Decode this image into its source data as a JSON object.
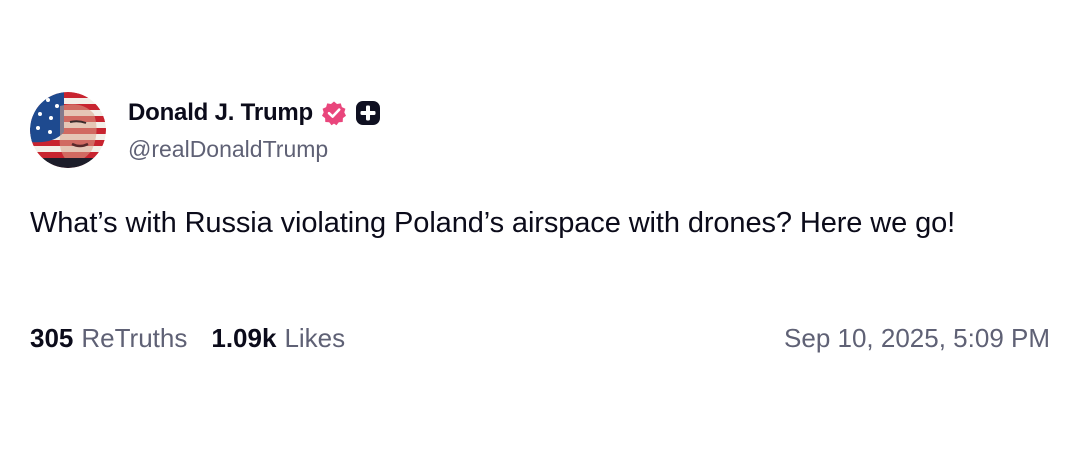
{
  "author": {
    "display_name": "Donald J. Trump",
    "handle": "@realDonaldTrump",
    "avatar_icon": "flag-portrait-avatar",
    "verified_icon": "verified-badge-icon",
    "verified_color": "#e9467c",
    "plus_icon": "plus-badge-icon"
  },
  "post": {
    "text": "What’s with Russia violating Poland’s airspace with drones? Here we go!"
  },
  "stats": {
    "retruths_count": "305",
    "retruths_label": "ReTruths",
    "likes_count": "1.09k",
    "likes_label": "Likes"
  },
  "timestamp": "Sep 10, 2025, 5:09 PM",
  "colors": {
    "text_primary": "#0b0b1a",
    "text_secondary": "#5f6175",
    "background": "#ffffff"
  }
}
